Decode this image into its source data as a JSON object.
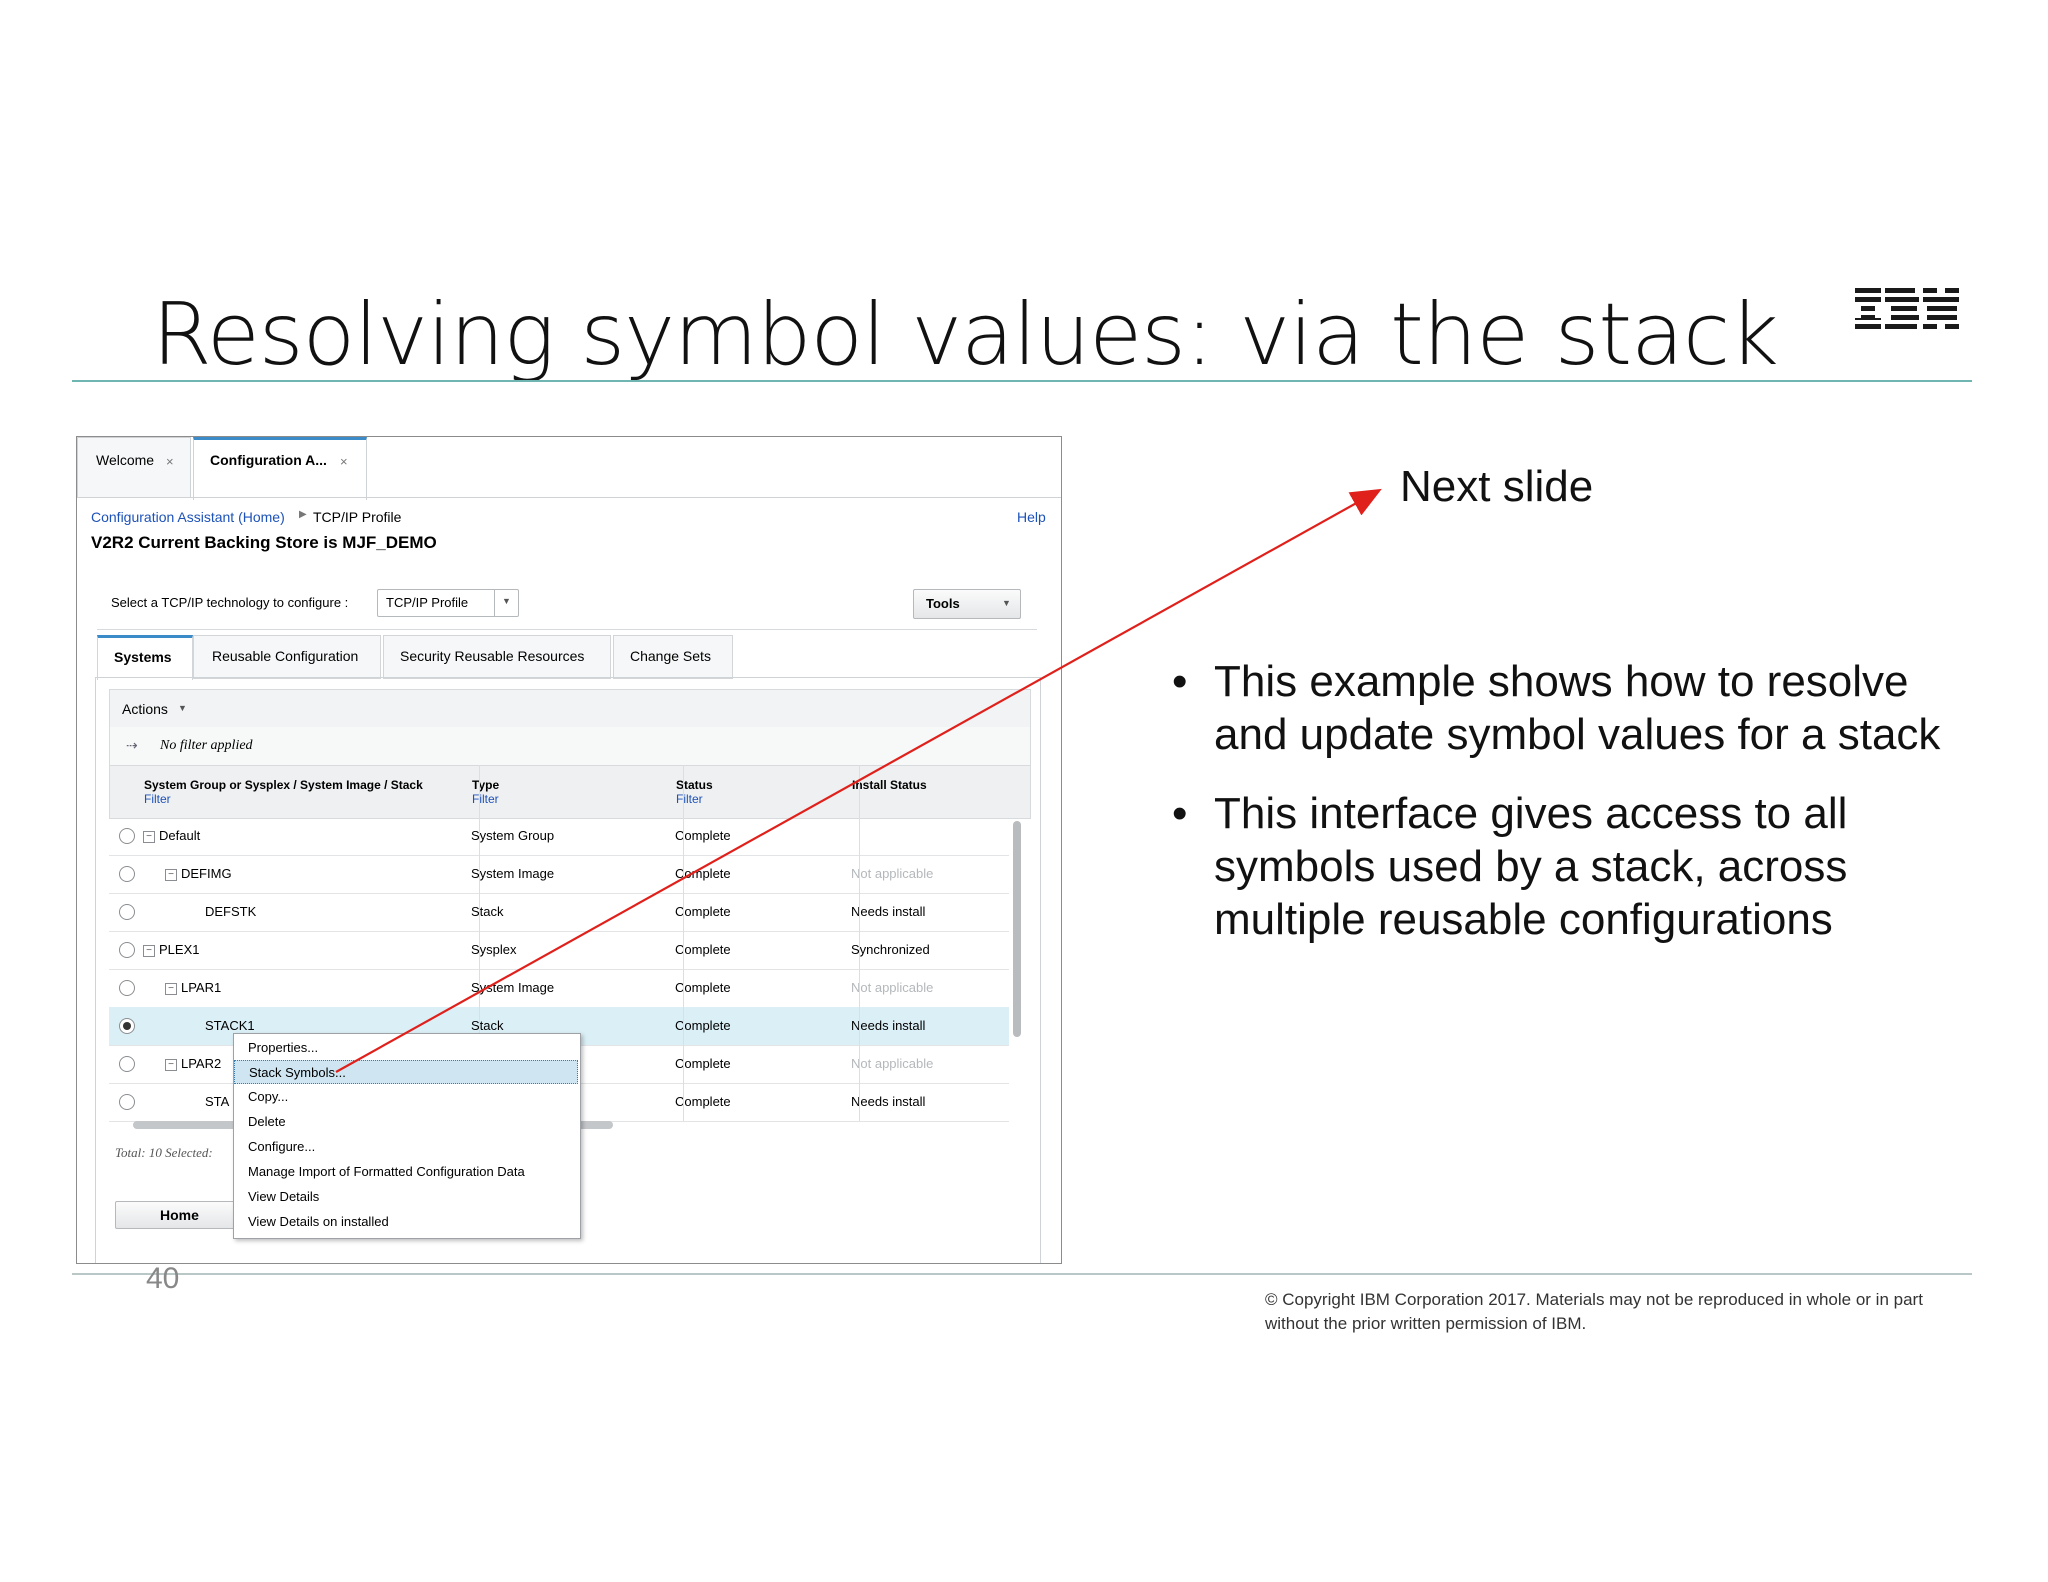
{
  "slide": {
    "title": "Resolving symbol values: via the stack",
    "next_slide_label": "Next slide",
    "bullets": [
      "This example shows how to resolve and update symbol values for a stack",
      "This interface gives access to all symbols used by a stack, across multiple reusable configurations"
    ],
    "page_number": "40",
    "copyright": "© Copyright IBM Corporation 2017.  Materials may not be reproduced in whole or in part without the prior written permission of IBM.",
    "logo_text": "IBM",
    "arrow_color": "#e0201b"
  },
  "app": {
    "top_tabs": [
      {
        "label": "Welcome",
        "close": "×"
      },
      {
        "label": "Configuration A...",
        "close": "×"
      }
    ],
    "breadcrumb_home": "Configuration Assistant (Home)",
    "breadcrumb_current": "TCP/IP Profile",
    "help": "Help",
    "heading": "V2R2 Current Backing Store is MJF_DEMO",
    "tech_label": "Select a TCP/IP technology to configure :",
    "tech_value": "TCP/IP Profile",
    "tools_label": "Tools",
    "sub_tabs": [
      "Systems",
      "Reusable Configuration",
      "Security Reusable Resources",
      "Change Sets"
    ],
    "actions_label": "Actions",
    "filter_text": "No filter applied",
    "columns": [
      {
        "label": "System Group or Sysplex / System Image / Stack",
        "filter": "Filter"
      },
      {
        "label": "Type",
        "filter": "Filter"
      },
      {
        "label": "Status",
        "filter": "Filter"
      },
      {
        "label": "Install Status",
        "filter": ""
      }
    ],
    "rows": [
      {
        "name": "Default",
        "type": "System Group",
        "status": "Complete",
        "install": ""
      },
      {
        "name": "DEFIMG",
        "type": "System Image",
        "status": "Complete",
        "install": "Not applicable"
      },
      {
        "name": "DEFSTK",
        "type": "Stack",
        "status": "Complete",
        "install": "Needs install"
      },
      {
        "name": "PLEX1",
        "type": "Sysplex",
        "status": "Complete",
        "install": "Synchronized"
      },
      {
        "name": "LPAR1",
        "type": "System Image",
        "status": "Complete",
        "install": "Not applicable"
      },
      {
        "name": "STACK1",
        "type": "Stack",
        "status": "Complete",
        "install": "Needs install"
      },
      {
        "name": "LPAR2",
        "type": "",
        "status": "Complete",
        "install": "Not applicable"
      },
      {
        "name": "STA",
        "type": "",
        "status": "Complete",
        "install": "Needs install"
      }
    ],
    "total_text": "Total: 10 Selected:",
    "home_button": "Home",
    "context_menu": [
      "Properties...",
      "Stack Symbols...",
      "Copy...",
      "Delete",
      "Configure...",
      "Manage Import of Formatted Configuration Data",
      "View Details",
      "View Details on installed"
    ]
  }
}
